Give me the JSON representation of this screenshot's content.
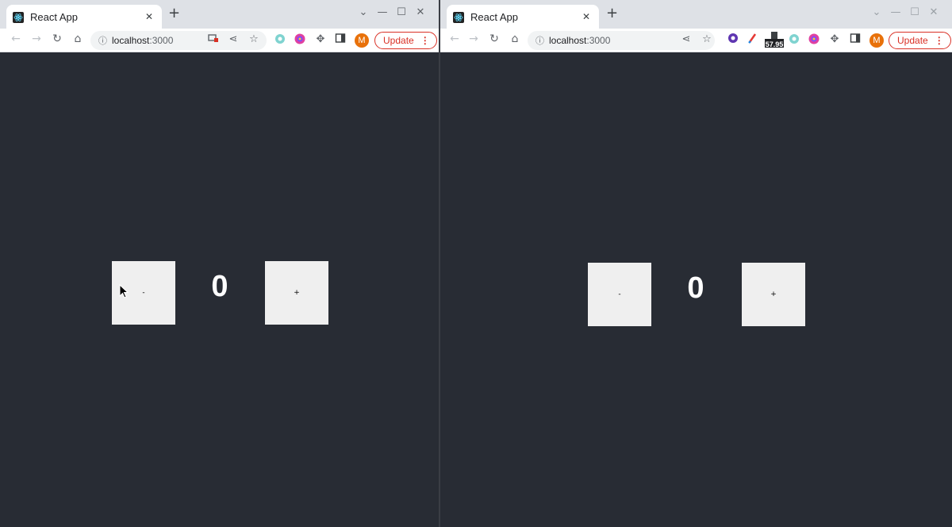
{
  "windows": [
    {
      "tab": {
        "title": "React App",
        "close": "✕"
      },
      "new_tab": "+",
      "window_controls": [
        "⌄",
        "—",
        "☐",
        "✕"
      ],
      "nav": {
        "back": "←",
        "forward": "→",
        "reload": "↻",
        "home": "⌂"
      },
      "address": {
        "host": "localhost",
        "port": ":3000"
      },
      "extensions": [
        "cast-blocked-icon",
        "share-icon",
        "star-icon",
        "puzzle-extension-icon",
        "pinwheel-extension-icon",
        "extensions-icon",
        "sidepanel-icon"
      ],
      "avatar": "M",
      "update_label": "Update",
      "menu": "⋮",
      "app": {
        "decrement_label": "-",
        "increment_label": "+",
        "count": "0"
      }
    },
    {
      "tab": {
        "title": "React App",
        "close": "✕"
      },
      "new_tab": "+",
      "window_controls": [
        "⌄",
        "—",
        "☐",
        "✕"
      ],
      "nav": {
        "back": "←",
        "forward": "→",
        "reload": "↻",
        "home": "⌂"
      },
      "address": {
        "host": "localhost",
        "port": ":3000"
      },
      "extensions": [
        "share-icon",
        "star-icon",
        "extension-icon",
        "brush-icon",
        "price-badge-icon",
        "puzzle-extension-icon",
        "pinwheel-extension-icon",
        "extensions-icon",
        "sidepanel-icon"
      ],
      "price_badge": "57.95",
      "avatar": "M",
      "update_label": "Update",
      "menu": "⋮",
      "app": {
        "decrement_label": "-",
        "increment_label": "+",
        "count": "0"
      }
    }
  ],
  "colors": {
    "app_background": "#282c34",
    "tabstrip": "#dee1e6",
    "update_accent": "#d93025",
    "avatar": "#e8710a",
    "button_face": "#efefef"
  }
}
